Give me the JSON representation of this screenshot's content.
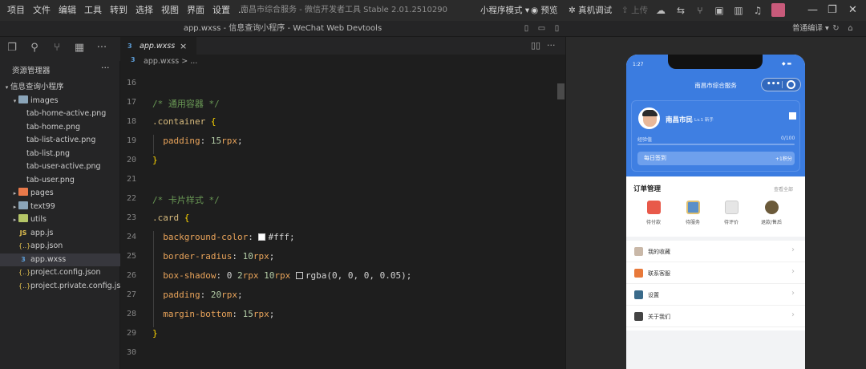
{
  "menubar": {
    "items": [
      "项目",
      "文件",
      "编辑",
      "工具",
      "转到",
      "选择",
      "视图",
      "界面",
      "设置",
      "..."
    ]
  },
  "app_title": "南昌市综合服务 - 微信开发者工具 Stable 2.01.2510290",
  "toolbar": {
    "mode": "小程序模式 ▾",
    "preview": "预览",
    "realdebug": "真机调试",
    "upload": "上传",
    "compile_mode": "普通编译 ▾"
  },
  "tabrow_title": "app.wxss - 信息查询小程序 - WeChat Web Devtools",
  "sidebar": {
    "title": "资源管理器",
    "more": "···",
    "tree": [
      {
        "label": "信息查询小程序",
        "depth": 0,
        "kind": "root",
        "twisty": "▾"
      },
      {
        "label": "images",
        "depth": 1,
        "kind": "folder-img",
        "twisty": "▾"
      },
      {
        "label": "tab-home-active.png",
        "depth": 2,
        "kind": "png"
      },
      {
        "label": "tab-home.png",
        "depth": 2,
        "kind": "png"
      },
      {
        "label": "tab-list-active.png",
        "depth": 2,
        "kind": "png"
      },
      {
        "label": "tab-list.png",
        "depth": 2,
        "kind": "png"
      },
      {
        "label": "tab-user-active.png",
        "depth": 2,
        "kind": "png"
      },
      {
        "label": "tab-user.png",
        "depth": 2,
        "kind": "png"
      },
      {
        "label": "pages",
        "depth": 1,
        "kind": "folder-pages",
        "twisty": "▸"
      },
      {
        "label": "text99",
        "depth": 1,
        "kind": "folder",
        "twisty": "▸"
      },
      {
        "label": "utils",
        "depth": 1,
        "kind": "folder-utils",
        "twisty": "▸"
      },
      {
        "label": "app.js",
        "depth": 1,
        "kind": "js"
      },
      {
        "label": "app.json",
        "depth": 1,
        "kind": "json"
      },
      {
        "label": "app.wxss",
        "depth": 1,
        "kind": "css",
        "active": true
      },
      {
        "label": "project.config.json",
        "depth": 1,
        "kind": "json"
      },
      {
        "label": "project.private.config.js...",
        "depth": 1,
        "kind": "json"
      }
    ]
  },
  "editor": {
    "tab_label": "app.wxss",
    "tab_close": "×",
    "breadcrumb": "app.wxss > ...",
    "line_numbers": [
      "16",
      "17",
      "18",
      "19",
      "20",
      "21",
      "22",
      "23",
      "24",
      "25",
      "26",
      "27",
      "28",
      "29",
      "30"
    ],
    "lines": [
      "",
      "/* 通用容器 */",
      ".container {",
      "  padding: 15rpx;",
      "}",
      "",
      "/* 卡片样式 */",
      ".card {",
      "  background-color: #fff;",
      "  border-radius: 10rpx;",
      "  box-shadow: 0 2rpx 10rpx rgba(0, 0, 0, 0.05);",
      "  padding: 20rpx;",
      "  margin-bottom: 15rpx;",
      "}",
      ""
    ]
  },
  "simulator": {
    "status_time": "1:27",
    "status_icons": "◆ ▬",
    "nav_title": "南昌市综合服务",
    "capsule_dots": "•••",
    "user_name": "南昌市民",
    "user_level": "Lv.1 新手",
    "exp_label": "经验值",
    "exp_value": "0/100",
    "exp_progress": 0,
    "signin_label": "每日签到",
    "signin_points": "+1积分",
    "order_title": "订单管理",
    "order_all": "查看全部",
    "order_items": [
      "待付款",
      "待服务",
      "待评价",
      "退款/售后"
    ],
    "menu_items": [
      "我的收藏",
      "联系客服",
      "设置",
      "关于我们"
    ]
  },
  "colors": {
    "accent_blue": "#3b7ce0",
    "editor_bg": "#1e1e1e",
    "sidebar_bg": "#252526"
  }
}
